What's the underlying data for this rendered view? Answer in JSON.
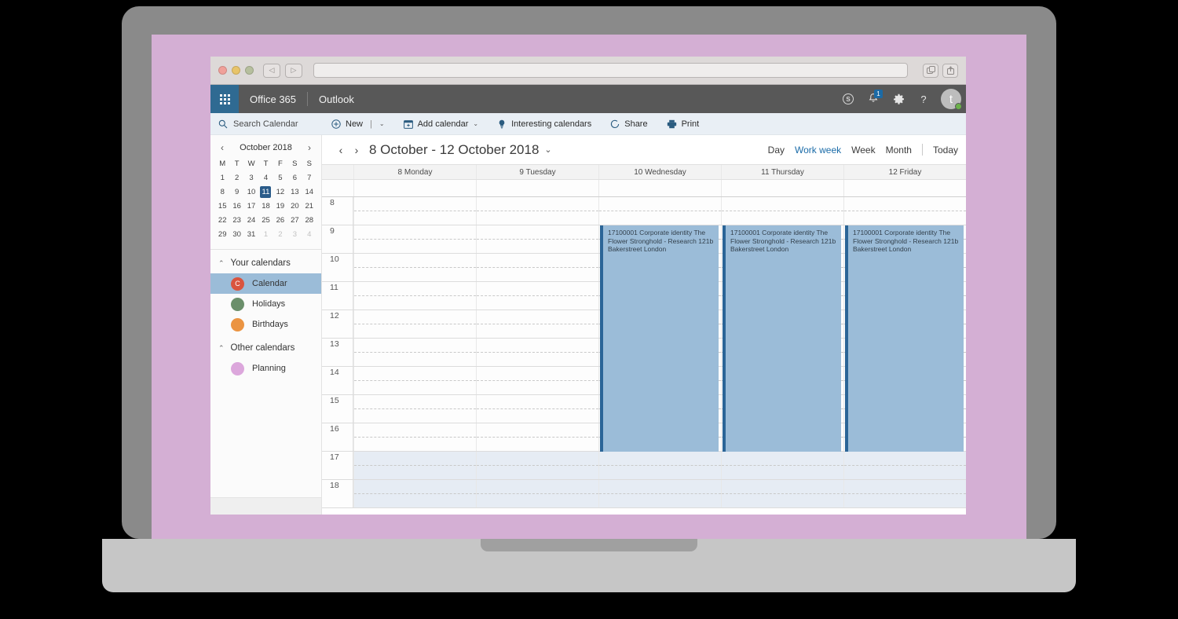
{
  "browser": {
    "back_icon": "◁",
    "forward_icon": "▷",
    "url_value": "",
    "url_placeholder": "",
    "tabs_icon": "tabs-icon",
    "share_icon": "share-icon"
  },
  "suitebar": {
    "waffle": "app-launcher",
    "brand": "Office 365",
    "app": "Outlook",
    "skype_label": "S",
    "notifications_count": "1",
    "settings_icon": "gear-icon",
    "help_icon": "?",
    "avatar_initial": "t"
  },
  "commandbar": {
    "search_placeholder": "Search Calendar",
    "items": [
      {
        "label": "New",
        "icon": "plus-circle-icon",
        "caret": "⌄"
      },
      {
        "label": "Add calendar",
        "icon": "calendar-plus-icon",
        "caret": "⌄"
      },
      {
        "label": "Interesting calendars",
        "icon": "bulb-icon",
        "caret": ""
      },
      {
        "label": "Share",
        "icon": "share-circle-icon",
        "caret": ""
      },
      {
        "label": "Print",
        "icon": "printer-icon",
        "caret": ""
      }
    ]
  },
  "minicalendar": {
    "title": "October 2018",
    "prev": "‹",
    "next": "›",
    "dow": [
      "M",
      "T",
      "W",
      "T",
      "F",
      "S",
      "S"
    ],
    "weeks": [
      [
        {
          "d": "1"
        },
        {
          "d": "2"
        },
        {
          "d": "3"
        },
        {
          "d": "4"
        },
        {
          "d": "5"
        },
        {
          "d": "6"
        },
        {
          "d": "7"
        }
      ],
      [
        {
          "d": "8"
        },
        {
          "d": "9"
        },
        {
          "d": "10"
        },
        {
          "d": "11",
          "selected": true
        },
        {
          "d": "12"
        },
        {
          "d": "13"
        },
        {
          "d": "14"
        }
      ],
      [
        {
          "d": "15"
        },
        {
          "d": "16"
        },
        {
          "d": "17"
        },
        {
          "d": "18"
        },
        {
          "d": "19"
        },
        {
          "d": "20"
        },
        {
          "d": "21"
        }
      ],
      [
        {
          "d": "22"
        },
        {
          "d": "23"
        },
        {
          "d": "24"
        },
        {
          "d": "25"
        },
        {
          "d": "26"
        },
        {
          "d": "27"
        },
        {
          "d": "28"
        }
      ],
      [
        {
          "d": "29"
        },
        {
          "d": "30"
        },
        {
          "d": "31"
        },
        {
          "d": "1",
          "muted": true
        },
        {
          "d": "2",
          "muted": true
        },
        {
          "d": "3",
          "muted": true
        },
        {
          "d": "4",
          "muted": true
        }
      ]
    ]
  },
  "calendarlist": {
    "groups": [
      {
        "title": "Your calendars",
        "chevron": "⌃",
        "items": [
          {
            "label": "Calendar",
            "color": "#d9543f",
            "initial": "C",
            "active": true
          },
          {
            "label": "Holidays",
            "color": "#6b8f6b",
            "initial": "",
            "active": false
          },
          {
            "label": "Birthdays",
            "color": "#eb9442",
            "initial": "",
            "active": false
          }
        ]
      },
      {
        "title": "Other calendars",
        "chevron": "⌃",
        "items": [
          {
            "label": "Planning",
            "color": "#dca7dc",
            "initial": "",
            "active": false
          }
        ]
      }
    ]
  },
  "calendar": {
    "prev": "‹",
    "next": "›",
    "range_title": "8 October - 12 October 2018",
    "range_caret": "⌄",
    "views": [
      "Day",
      "Work week",
      "Week",
      "Month"
    ],
    "selected_view": "Work week",
    "today_label": "Today",
    "days": [
      "8 Monday",
      "9 Tuesday",
      "10 Wednesday",
      "11 Thursday",
      "12 Friday"
    ],
    "hours": [
      "8",
      "9",
      "10",
      "11",
      "12",
      "13",
      "14",
      "15",
      "16",
      "17",
      "18"
    ],
    "working_hours_end": "17",
    "event_color": "#9bbcd8",
    "event_border_color": "#2b6597",
    "events": [
      {
        "day_index": 2,
        "start_hour": "9",
        "end_hour": "17",
        "text": "17100001 Corporate identity The Flower Stronghold - Research 121b Bakerstreet London"
      },
      {
        "day_index": 3,
        "start_hour": "9",
        "end_hour": "17",
        "text": "17100001 Corporate identity The Flower Stronghold - Research 121b Bakerstreet London"
      },
      {
        "day_index": 4,
        "start_hour": "9",
        "end_hour": "17",
        "text": "17100001 Corporate identity The Flower Stronghold - Research 121b Bakerstreet London"
      }
    ]
  },
  "theme": {
    "wallpaper": "#d4afd4",
    "suite_bar": "#585858",
    "accent": "#2f6a92"
  }
}
